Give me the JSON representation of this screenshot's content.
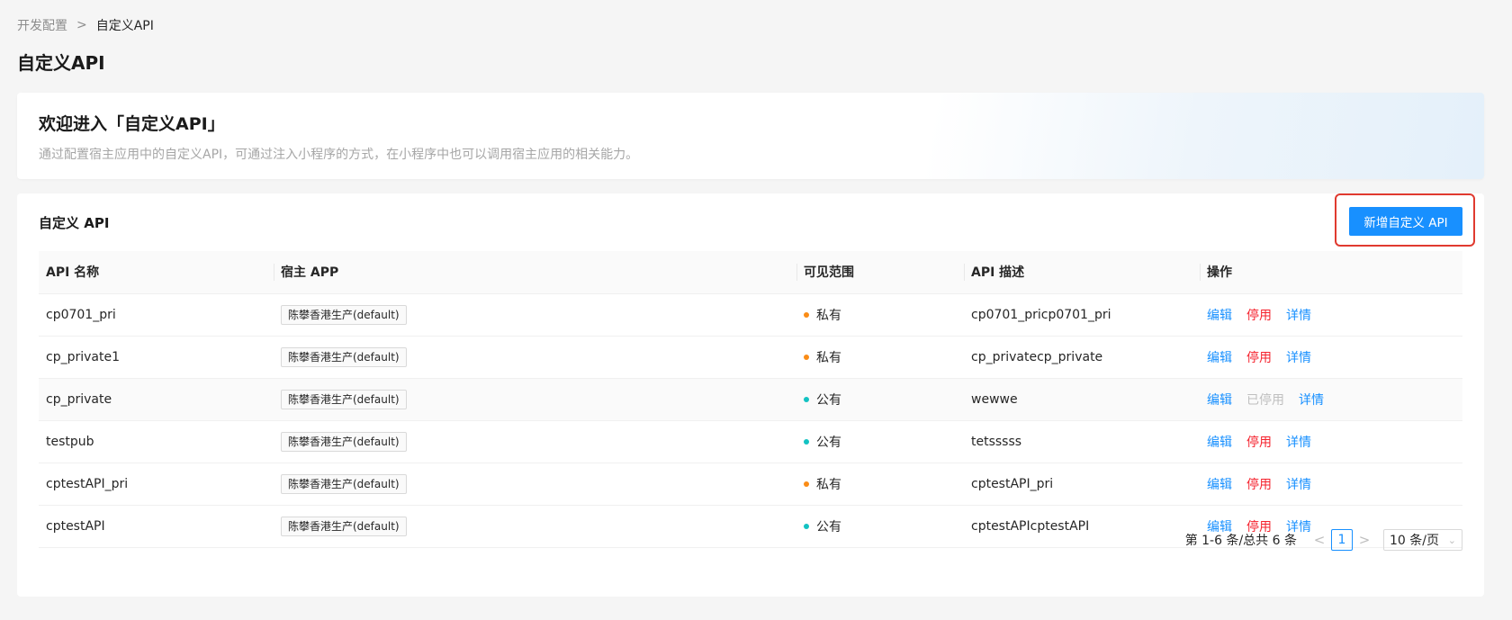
{
  "breadcrumb": {
    "parent": "开发配置",
    "separator": ">",
    "current": "自定义API"
  },
  "page_title": "自定义API",
  "welcome": {
    "title": "欢迎进入「自定义API」",
    "description": "通过配置宿主应用中的自定义API，可通过注入小程序的方式，在小程序中也可以调用宿主应用的相关能力。"
  },
  "section": {
    "title": "自定义 API",
    "add_button": "新增自定义 API"
  },
  "table": {
    "headers": [
      "API 名称",
      "宿主 APP",
      "可见范围",
      "API 描述",
      "操作"
    ],
    "rows": [
      {
        "name": "cp0701_pri",
        "app": "陈攀香港生产(default)",
        "scope": "私有",
        "scope_color": "#fa8c16",
        "desc": "cp0701_pricp0701_pri",
        "edit": "编辑",
        "stop": "停用",
        "detail": "详情",
        "stopped": false
      },
      {
        "name": "cp_private1",
        "app": "陈攀香港生产(default)",
        "scope": "私有",
        "scope_color": "#fa8c16",
        "desc": "cp_privatecp_private",
        "edit": "编辑",
        "stop": "停用",
        "detail": "详情",
        "stopped": false
      },
      {
        "name": "cp_private",
        "app": "陈攀香港生产(default)",
        "scope": "公有",
        "scope_color": "#13c2c2",
        "desc": "wewwe",
        "edit": "编辑",
        "stop": "已停用",
        "detail": "详情",
        "stopped": true
      },
      {
        "name": "testpub",
        "app": "陈攀香港生产(default)",
        "scope": "公有",
        "scope_color": "#13c2c2",
        "desc": "tetsssss",
        "edit": "编辑",
        "stop": "停用",
        "detail": "详情",
        "stopped": false
      },
      {
        "name": "cptestAPI_pri",
        "app": "陈攀香港生产(default)",
        "scope": "私有",
        "scope_color": "#fa8c16",
        "desc": "cptestAPI_pri",
        "edit": "编辑",
        "stop": "停用",
        "detail": "详情",
        "stopped": false
      },
      {
        "name": "cptestAPI",
        "app": "陈攀香港生产(default)",
        "scope": "公有",
        "scope_color": "#13c2c2",
        "desc": "cptestAPIcptestAPI",
        "edit": "编辑",
        "stop": "停用",
        "detail": "详情",
        "stopped": false
      }
    ]
  },
  "pagination": {
    "total_text": "第 1-6 条/总共 6 条",
    "prev_icon": "<",
    "current_page": "1",
    "next_icon": ">",
    "page_size": "10 条/页"
  },
  "colors": {
    "primary": "#1890ff",
    "danger": "#f5222d",
    "private": "#fa8c16",
    "public": "#13c2c2",
    "highlight_border": "#e03a2f"
  }
}
